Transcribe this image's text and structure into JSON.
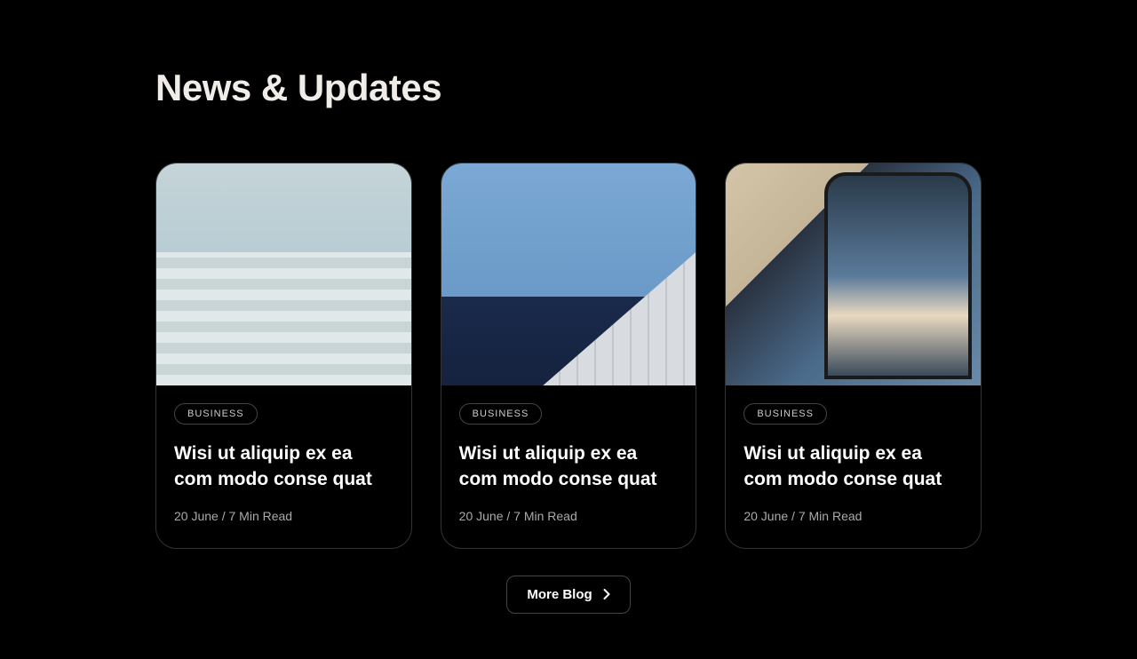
{
  "section": {
    "title": "News & Updates"
  },
  "cards": [
    {
      "category": "BUSINESS",
      "title": "Wisi ut aliquip ex ea com modo conse quat",
      "meta": "20 June / 7 Min Read"
    },
    {
      "category": "BUSINESS",
      "title": "Wisi ut aliquip ex ea com modo conse quat",
      "meta": "20 June / 7 Min Read"
    },
    {
      "category": "BUSINESS",
      "title": "Wisi ut aliquip ex ea com modo conse quat",
      "meta": "20 June / 7 Min Read"
    }
  ],
  "button": {
    "label": "More Blog"
  }
}
